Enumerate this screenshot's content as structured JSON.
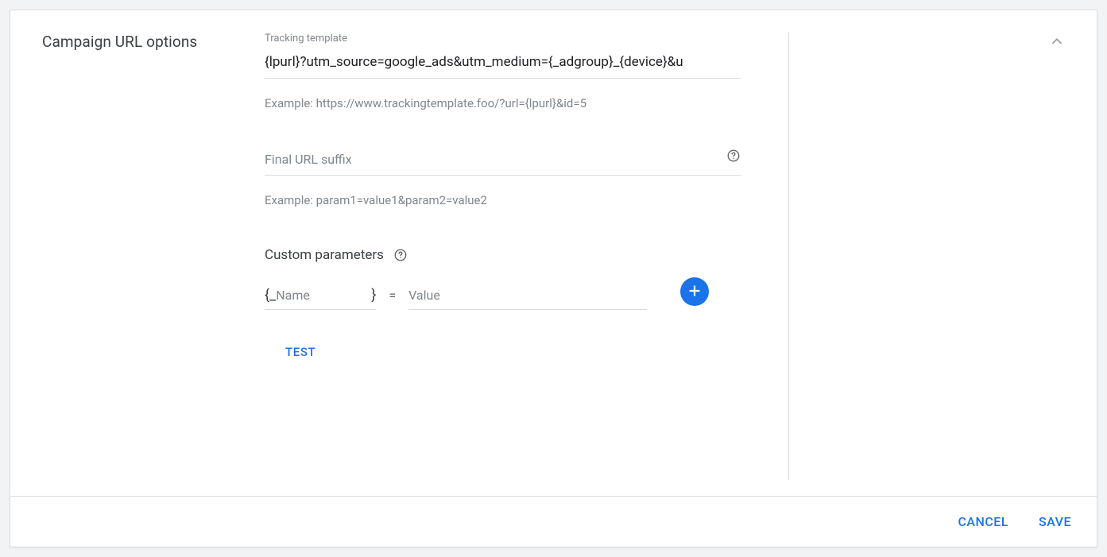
{
  "section": {
    "title": "Campaign URL options"
  },
  "tracking": {
    "label": "Tracking template",
    "value": "{lpurl}?utm_source=google_ads&utm_medium={_adgroup}_{device}&u",
    "example": "Example: https://www.trackingtemplate.foo/?url={lpurl}&id=5"
  },
  "suffix": {
    "placeholder": "Final URL suffix",
    "value": "",
    "example": "Example: param1=value1&param2=value2"
  },
  "custom": {
    "title": "Custom parameters",
    "brace_open": "{",
    "underscore": "_",
    "name_placeholder": "Name",
    "brace_close": "}",
    "equals": "=",
    "value_placeholder": "Value"
  },
  "buttons": {
    "test": "TEST",
    "cancel": "CANCEL",
    "save": "SAVE"
  }
}
